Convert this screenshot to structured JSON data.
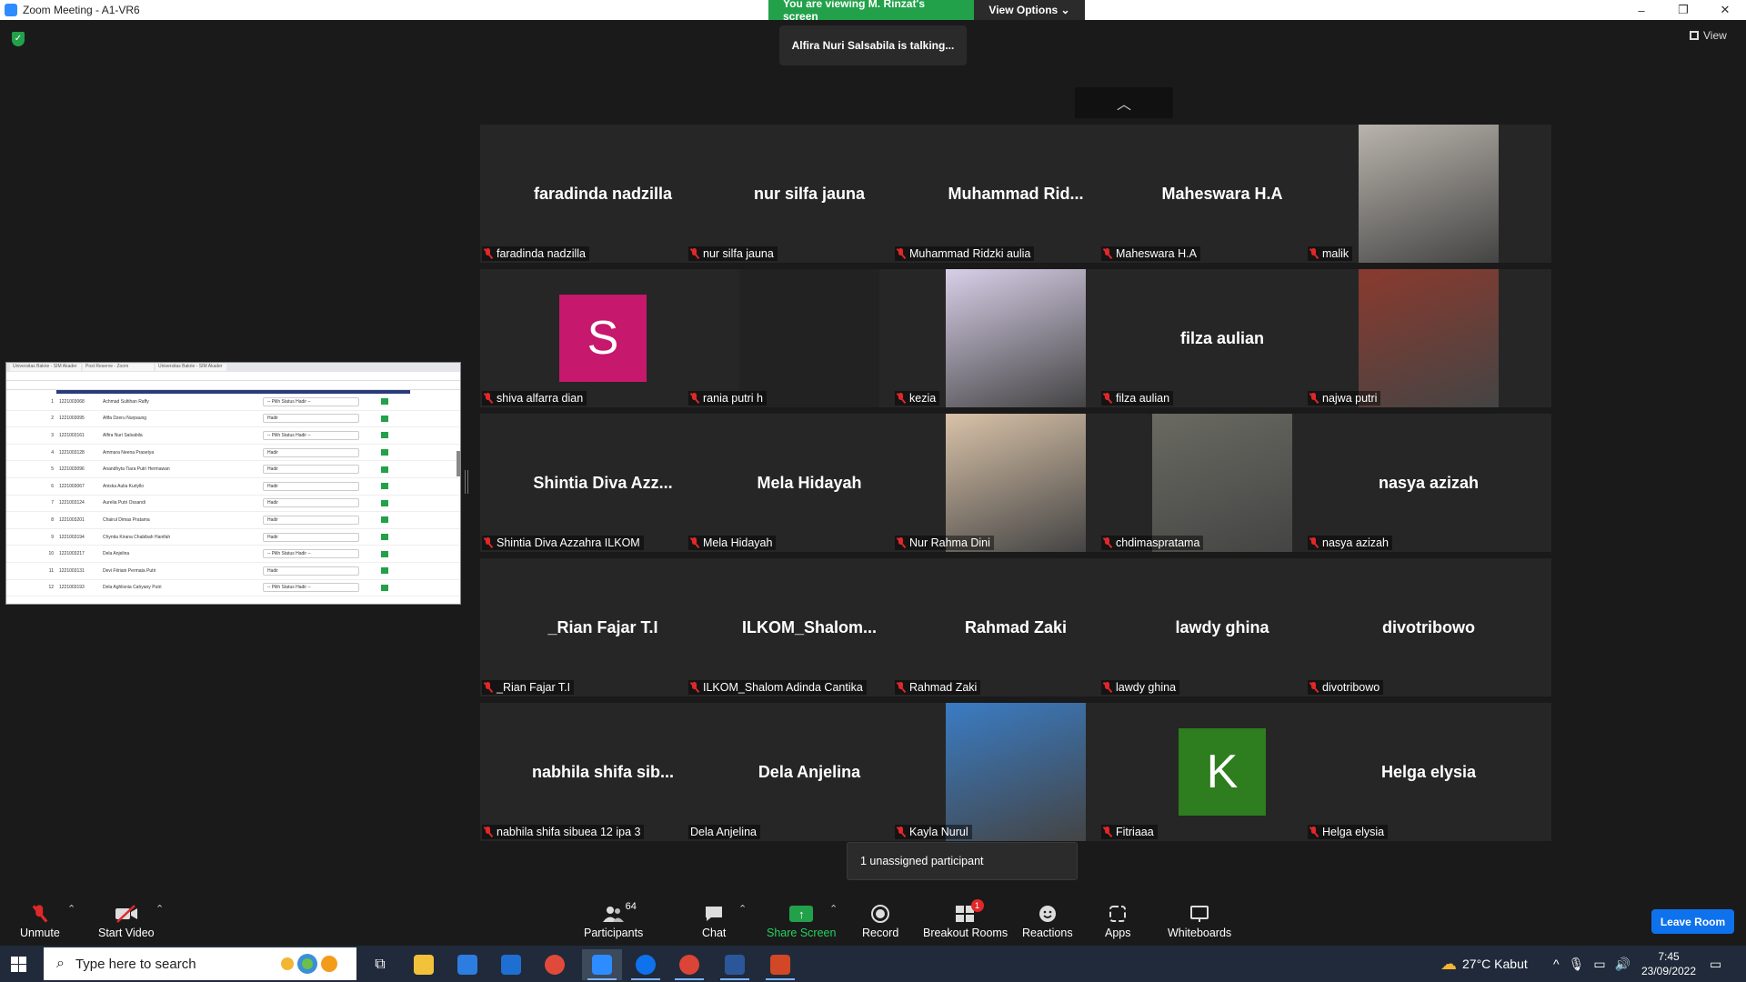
{
  "window": {
    "title": "Zoom Meeting - A1-VR6",
    "controls": [
      "–",
      "❐",
      "✕"
    ]
  },
  "banner": {
    "viewing": "You are viewing M. Rinzat's screen",
    "view_options": "View Options ⌄"
  },
  "talking": "Alfira Nuri Salsabila is talking...",
  "view_label": "View",
  "shared_screen": {
    "tabs": [
      "Universitas Bakrie - SIM Akader",
      "Post Reserve - Zoom",
      "Universitas Bakrie - SIM Akader"
    ],
    "rows": [
      {
        "no": "1",
        "nim": "1221003068",
        "name": "Achmad Sultihan Raffy",
        "status": "-- Pilih Status Hadir --"
      },
      {
        "no": "2",
        "nim": "1221003095",
        "name": "Afifa Dzeru Nurpaung",
        "status": "Hadir"
      },
      {
        "no": "3",
        "nim": "1221003161",
        "name": "Alfira Nuri Salsabila",
        "status": "-- Pilih Status Hadir --"
      },
      {
        "no": "4",
        "nim": "1221003128",
        "name": "Ammara Neena Prasetya",
        "status": "Hadir"
      },
      {
        "no": "5",
        "nim": "1221003096",
        "name": "Anandhyta Tiara Putri Hermawan",
        "status": "Hadir"
      },
      {
        "no": "6",
        "nim": "1221003067",
        "name": "Aniska Aulia Kurlyllo",
        "status": "Hadir"
      },
      {
        "no": "7",
        "nim": "1221003124",
        "name": "Aurelia Putri Ossandi",
        "status": "Hadir"
      },
      {
        "no": "8",
        "nim": "1221003201",
        "name": "Chairul Dimas Pratama",
        "status": "Hadir"
      },
      {
        "no": "9",
        "nim": "1221003194",
        "name": "Chyntia Kirana Chabibah Hanifah",
        "status": "Hadir"
      },
      {
        "no": "10",
        "nim": "1221003217",
        "name": "Dela Anjelina",
        "status": "-- Pilih Status Hadir --"
      },
      {
        "no": "11",
        "nim": "1221003131",
        "name": "Devi Fitriani Permata Putri",
        "status": "Hadir"
      },
      {
        "no": "12",
        "nim": "1221003193",
        "name": "Dela Aghlisnia Cahyany Putri",
        "status": "-- Pilih Status Hadir --"
      }
    ]
  },
  "tiles": [
    {
      "big": "faradinda nadzilla",
      "label": "faradinda nadzilla",
      "muted": true,
      "kind": "name"
    },
    {
      "big": "nur silfa jauna",
      "label": "nur silfa jauna",
      "muted": true,
      "kind": "name"
    },
    {
      "big": "Muhammad  Rid...",
      "label": "Muhammad Ridzki aulia",
      "muted": true,
      "kind": "name"
    },
    {
      "big": "Maheswara H.A",
      "label": "Maheswara H.A",
      "muted": true,
      "kind": "name"
    },
    {
      "big": "",
      "label": "malik",
      "muted": true,
      "kind": "photo",
      "color": "#b9b4ac"
    },
    {
      "big": "S",
      "label": "shiva alfarra dian",
      "muted": true,
      "kind": "avatar",
      "color": "#c6186c"
    },
    {
      "big": "",
      "label": "rania putri h",
      "muted": true,
      "kind": "dark"
    },
    {
      "big": "",
      "label": "kezia",
      "muted": true,
      "kind": "photo",
      "color": "#d8cfe8"
    },
    {
      "big": "filza aulian",
      "label": "filza aulian",
      "muted": true,
      "kind": "name"
    },
    {
      "big": "",
      "label": "najwa putri",
      "muted": true,
      "kind": "photo",
      "color": "#8a3a2e"
    },
    {
      "big": "Shintia  Diva  Azz...",
      "label": "Shintia Diva Azzahra ILKOM",
      "muted": true,
      "kind": "name"
    },
    {
      "big": "Mela Hidayah",
      "label": "Mela Hidayah",
      "muted": true,
      "kind": "name"
    },
    {
      "big": "",
      "label": "Nur Rahma Dini",
      "muted": true,
      "kind": "photo",
      "color": "#d9c2a8"
    },
    {
      "big": "",
      "label": "chdimaspratama",
      "muted": true,
      "kind": "photo",
      "color": "#6a6a62"
    },
    {
      "big": "nasya azizah",
      "label": "nasya azizah",
      "muted": true,
      "kind": "name"
    },
    {
      "big": "_Rian Fajar T.I",
      "label": "_Rian Fajar T.I",
      "muted": true,
      "kind": "name"
    },
    {
      "big": "ILKOM_Shalom...",
      "label": "ILKOM_Shalom Adinda Cantika",
      "muted": true,
      "kind": "name"
    },
    {
      "big": "Rahmad Zaki",
      "label": "Rahmad Zaki",
      "muted": true,
      "kind": "name"
    },
    {
      "big": "lawdy ghina",
      "label": "lawdy ghina",
      "muted": true,
      "kind": "name"
    },
    {
      "big": "divotribowo",
      "label": "divotribowo",
      "muted": true,
      "kind": "name"
    },
    {
      "big": "nabhila  shifa  sib...",
      "label": "nabhila shifa sibuea 12 ipa 3",
      "muted": true,
      "kind": "name"
    },
    {
      "big": "Dela Anjelina",
      "label": "Dela Anjelina",
      "muted": false,
      "kind": "name"
    },
    {
      "big": "",
      "label": "Kayla Nurul",
      "muted": true,
      "kind": "photo",
      "color": "#3a7cc4"
    },
    {
      "big": "K",
      "label": "Fitriaaa",
      "muted": true,
      "kind": "avatar",
      "color": "#2e7d1e"
    },
    {
      "big": "Helga elysia",
      "label": "Helga elysia",
      "muted": true,
      "kind": "name"
    }
  ],
  "toast": "1 unassigned participant",
  "toolbar": {
    "unmute": "Unmute",
    "start_video": "Start Video",
    "participants": "Participants",
    "participants_count": "64",
    "chat": "Chat",
    "share_screen": "Share Screen",
    "record": "Record",
    "breakout_rooms": "Breakout Rooms",
    "breakout_badge": "1",
    "reactions": "Reactions",
    "apps": "Apps",
    "whiteboards": "Whiteboards",
    "leave": "Leave Room"
  },
  "taskbar": {
    "search_placeholder": "Type here to search",
    "weather": "27°C  Kabut",
    "time": "7:45",
    "date": "23/09/2022"
  },
  "colors": {
    "accent_blue": "#0e72ed",
    "green": "#23a14a",
    "mute_red": "#e02828"
  }
}
